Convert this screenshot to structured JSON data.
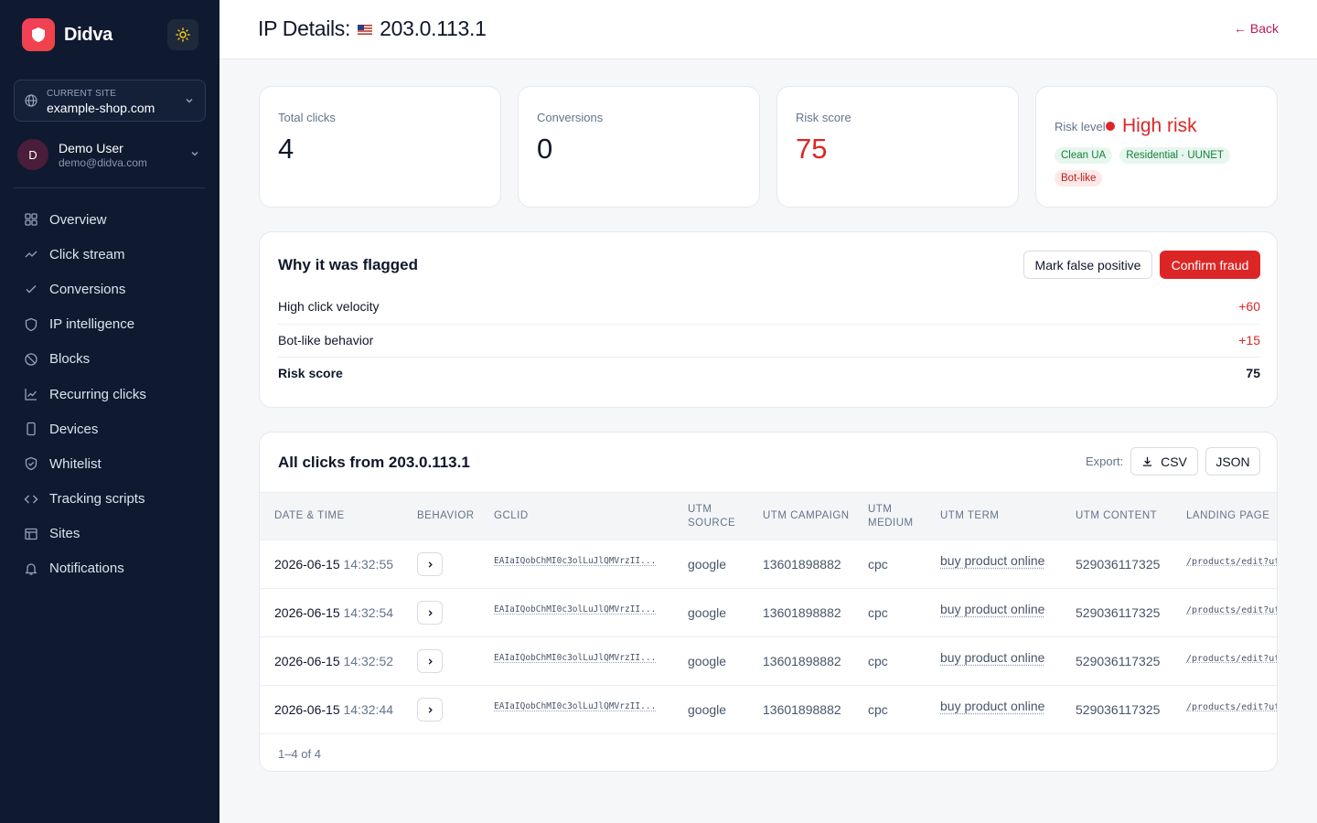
{
  "brand": {
    "name": "Didva"
  },
  "site": {
    "label": "CURRENT SITE",
    "name": "example-shop.com"
  },
  "user": {
    "initial": "D",
    "name": "Demo User",
    "email": "demo@didva.com"
  },
  "nav": [
    {
      "label": "Overview",
      "icon": "grid-icon"
    },
    {
      "label": "Click stream",
      "icon": "trend-icon"
    },
    {
      "label": "Conversions",
      "icon": "check-icon"
    },
    {
      "label": "IP intelligence",
      "icon": "shield-icon"
    },
    {
      "label": "Blocks",
      "icon": "ban-icon"
    },
    {
      "label": "Recurring clicks",
      "icon": "chart-icon"
    },
    {
      "label": "Devices",
      "icon": "phone-icon"
    },
    {
      "label": "Whitelist",
      "icon": "shield-check-icon"
    },
    {
      "label": "Tracking scripts",
      "icon": "code-icon"
    },
    {
      "label": "Sites",
      "icon": "table-icon"
    },
    {
      "label": "Notifications",
      "icon": "bell-icon"
    }
  ],
  "header": {
    "title": "IP Details:",
    "ip": "203.0.113.1",
    "back": "← Back"
  },
  "stats": {
    "total_clicks": {
      "label": "Total clicks",
      "value": "4"
    },
    "conversions": {
      "label": "Conversions",
      "value": "0"
    },
    "risk_score": {
      "label": "Risk score",
      "value": "75"
    },
    "risk_level": {
      "label": "Risk level",
      "value": "High risk"
    }
  },
  "chips": [
    "Clean UA",
    "Residential · UUNET",
    "Bot-like"
  ],
  "flagged": {
    "title": "Why it was flagged",
    "mark_false": "Mark false positive",
    "confirm": "Confirm fraud",
    "reasons": [
      {
        "label": "High click velocity",
        "points": "+60"
      },
      {
        "label": "Bot-like behavior",
        "points": "+15"
      },
      {
        "label": "Risk score",
        "points": "75"
      }
    ]
  },
  "clicks": {
    "title": "All clicks from 203.0.113.1",
    "export_label": "Export:",
    "csv": "CSV",
    "json": "JSON",
    "columns": [
      "DATE & TIME",
      "BEHAVIOR",
      "GCLID",
      "UTM SOURCE",
      "UTM CAMPAIGN",
      "UTM MEDIUM",
      "UTM TERM",
      "UTM CONTENT",
      "LANDING PAGE"
    ],
    "rows": [
      {
        "date": "2026-06-15",
        "time": "14:32:55",
        "gclid": "EAIaIQobChMI0c3olLuJlQMVrzII...",
        "source": "google",
        "campaign": "13601898882",
        "medium": "cpc",
        "term": "buy product online",
        "content": "529036117325",
        "landing": "/products/edit?ut"
      },
      {
        "date": "2026-06-15",
        "time": "14:32:54",
        "gclid": "EAIaIQobChMI0c3olLuJlQMVrzII...",
        "source": "google",
        "campaign": "13601898882",
        "medium": "cpc",
        "term": "buy product online",
        "content": "529036117325",
        "landing": "/products/edit?ut"
      },
      {
        "date": "2026-06-15",
        "time": "14:32:52",
        "gclid": "EAIaIQobChMI0c3olLuJlQMVrzII...",
        "source": "google",
        "campaign": "13601898882",
        "medium": "cpc",
        "term": "buy product online",
        "content": "529036117325",
        "landing": "/products/edit?ut"
      },
      {
        "date": "2026-06-15",
        "time": "14:32:44",
        "gclid": "EAIaIQobChMI0c3olLuJlQMVrzII...",
        "source": "google",
        "campaign": "13601898882",
        "medium": "cpc",
        "term": "buy product online",
        "content": "529036117325",
        "landing": "/products/edit?ut"
      }
    ],
    "pagination": "1–4 of 4"
  },
  "colors": {
    "accent": "#dc2626",
    "sidebar": "#0f1a30",
    "back_link": "#be185d"
  }
}
